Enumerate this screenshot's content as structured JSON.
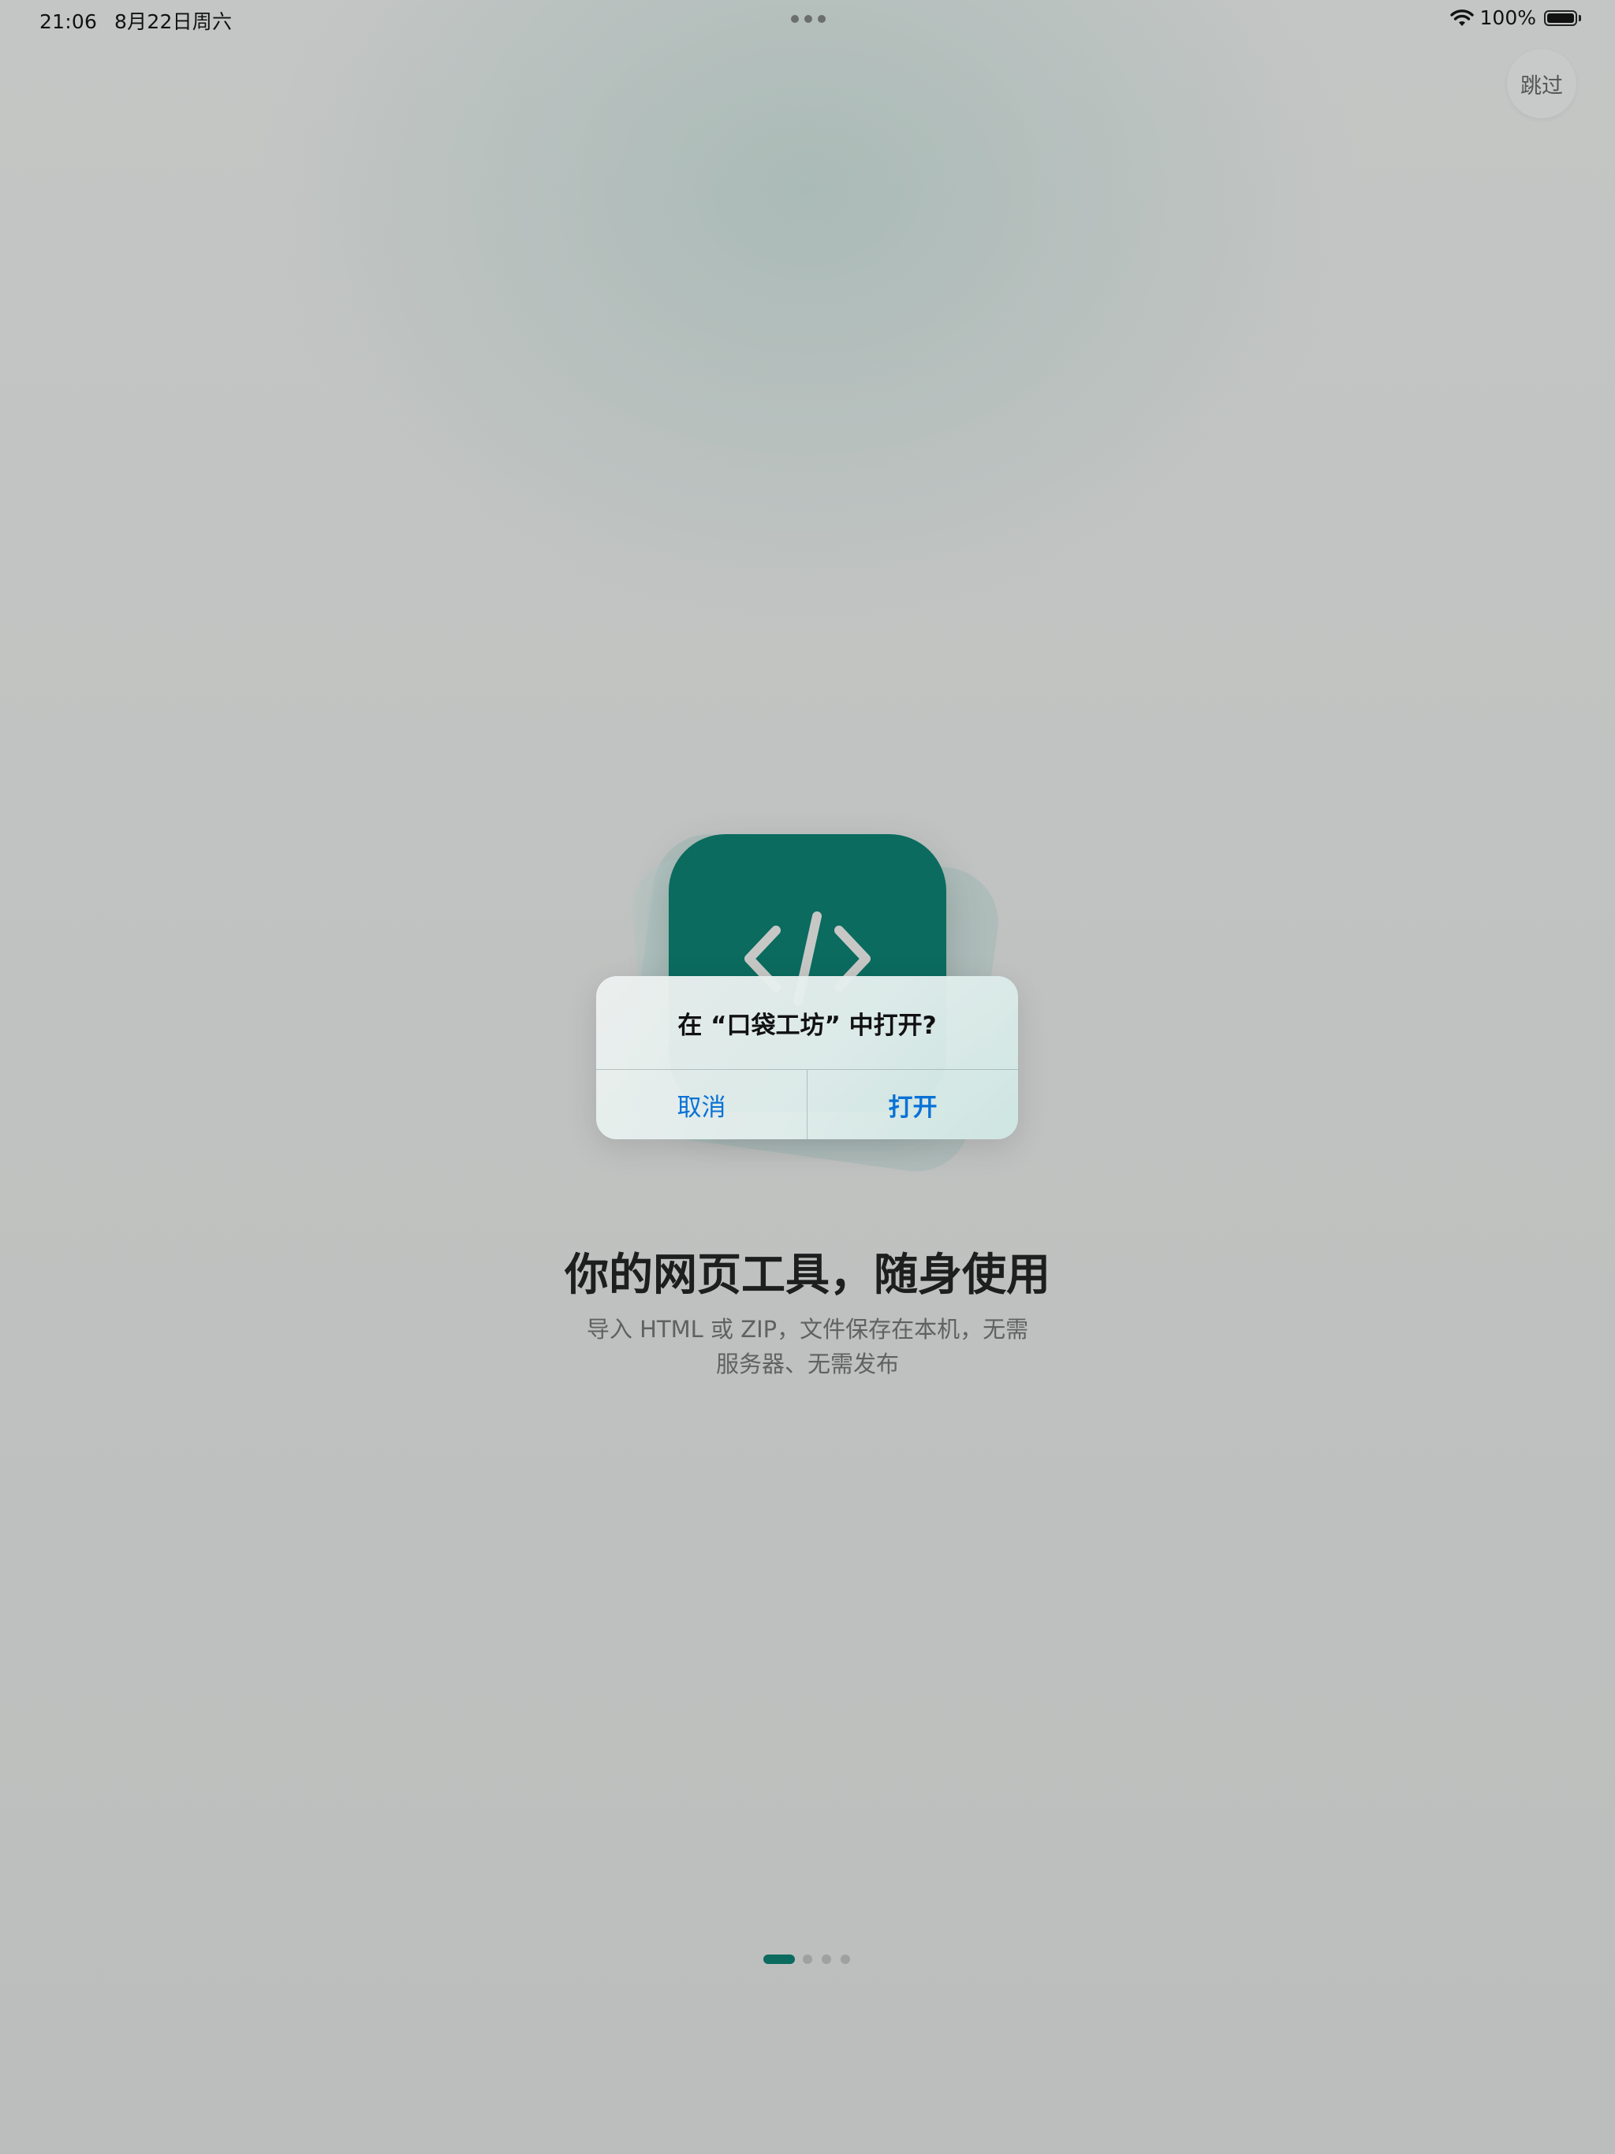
{
  "status_bar": {
    "time": "21:06",
    "date": "8月22日周六",
    "battery_percent": "100%",
    "battery_level": 1.0
  },
  "skip_button": {
    "label": "跳过"
  },
  "app_icon": {
    "icon": "code-brackets-icon",
    "color": "#0b6b5f"
  },
  "alert": {
    "title": "在 “口袋工坊” 中打开?",
    "cancel_label": "取消",
    "open_label": "打开",
    "button_color": "#0a72d6"
  },
  "onboarding": {
    "headline": "你的网页工具，随身使用",
    "subline_1": "导入 HTML 或 ZIP，文件保存在本机，无需",
    "subline_2": "服务器、无需发布",
    "page_current": 1,
    "page_total": 4
  }
}
